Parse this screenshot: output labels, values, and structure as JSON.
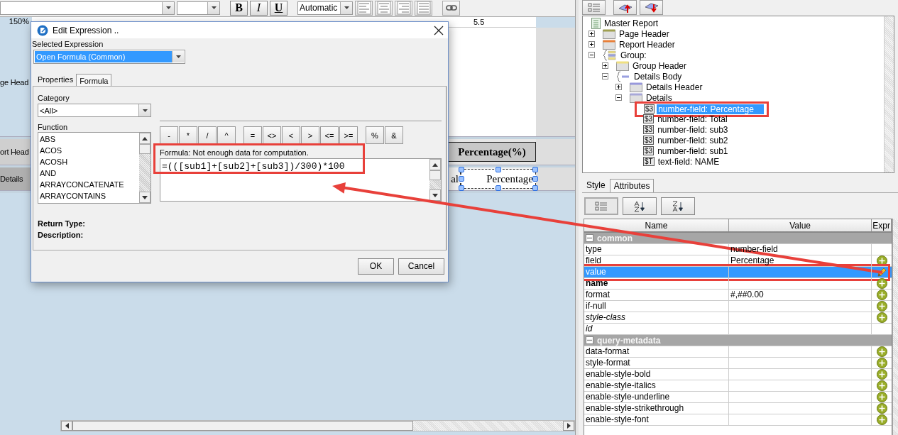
{
  "toolbar": {
    "format_buttons": [
      {
        "label": "B",
        "kind": "bold"
      },
      {
        "label": "I",
        "kind": "italic"
      },
      {
        "label": "U",
        "kind": "underline"
      }
    ],
    "color_select": "Automatic"
  },
  "canvas": {
    "zoom": "150%",
    "ruler_label": "5.5",
    "bands": [
      {
        "kind": "page-header",
        "label": "ge Head"
      },
      {
        "kind": "report-header",
        "label": "ort Head",
        "cells": [
          {
            "text": "Percentage(%)",
            "selected": false
          }
        ]
      },
      {
        "kind": "details",
        "label": "Details",
        "cells": [
          {
            "text": "al",
            "selected": false
          },
          {
            "text": "Percentage",
            "selected": true
          }
        ]
      }
    ]
  },
  "dialog": {
    "title": "Edit Expression ..",
    "selected_expression_label": "Selected Expression",
    "selected_expression": "Open Formula (Common)",
    "tabs": [
      {
        "label": "Properties",
        "selected": false
      },
      {
        "label": "Formula",
        "selected": true
      }
    ],
    "category_label": "Category",
    "category": "<All>",
    "function_label": "Function",
    "functions": [
      "ABS",
      "ACOS",
      "ACOSH",
      "AND",
      "ARRAYCONCATENATE",
      "ARRAYCONTAINS"
    ],
    "operators": [
      [
        "-",
        "*",
        "/",
        "^"
      ],
      [
        "=",
        "<>",
        "<",
        ">",
        "<=",
        ">="
      ],
      [
        "%",
        "&"
      ]
    ],
    "formula_label": "Formula: Not enough data for computation.",
    "formula": "=(([sub1]+[sub2]+[sub3])/300)*100",
    "formula_highlighted": true,
    "return_type_label": "Return Type:",
    "description_label": "Description:",
    "buttons": [
      "OK",
      "Cancel"
    ]
  },
  "outline": {
    "tree": [
      {
        "kind": "report",
        "label": "Master Report",
        "selected": false,
        "children": [
          {
            "kind": "band",
            "label": "Page Header",
            "color": "#a0a050",
            "expanded": false,
            "selected": false
          },
          {
            "kind": "band",
            "label": "Report Header",
            "color": "#e8803a",
            "expanded": false,
            "selected": false
          },
          {
            "kind": "group",
            "label": "Group:",
            "expanded": true,
            "selected": false,
            "children": [
              {
                "kind": "band",
                "label": "Group Header",
                "color": "#f0e080",
                "expanded": false,
                "selected": false
              },
              {
                "kind": "body",
                "label": "Details Body",
                "expanded": true,
                "selected": false,
                "children": [
                  {
                    "kind": "band",
                    "label": "Details Header",
                    "color": "#9898dc",
                    "expanded": false,
                    "selected": false
                  },
                  {
                    "kind": "band",
                    "label": "Details",
                    "color": "#a8a8d8",
                    "expanded": true,
                    "selected": false,
                    "children": [
                      {
                        "kind": "field",
                        "badge": "$3",
                        "label": "number-field: Percentage",
                        "selected": true,
                        "highlighted": true
                      },
                      {
                        "kind": "field",
                        "badge": "$3",
                        "label": "number-field: Total",
                        "selected": false,
                        "highlighted": false
                      },
                      {
                        "kind": "field",
                        "badge": "$3",
                        "label": "number-field: sub3",
                        "selected": false,
                        "highlighted": false
                      },
                      {
                        "kind": "field",
                        "badge": "$3",
                        "label": "number-field: sub2",
                        "selected": false,
                        "highlighted": false
                      },
                      {
                        "kind": "field",
                        "badge": "$3",
                        "label": "number-field: sub1",
                        "selected": false,
                        "highlighted": false
                      },
                      {
                        "kind": "field",
                        "badge": "$T",
                        "label": "text-field: NAME",
                        "selected": false,
                        "highlighted": false
                      }
                    ]
                  }
                ]
              }
            ]
          }
        ]
      }
    ]
  },
  "properties": {
    "tabs": [
      {
        "label": "Style",
        "selected": false
      },
      {
        "label": "Attributes",
        "selected": true
      }
    ],
    "columns": [
      "Name",
      "Value",
      "Expr"
    ],
    "rows": [
      {
        "kind": "group",
        "name": "common",
        "expanded": true
      },
      {
        "kind": "attribute",
        "name": "type",
        "value": "number-field",
        "bold": false,
        "italic": false,
        "expression_button": false,
        "selected": false,
        "highlighted": false
      },
      {
        "kind": "attribute",
        "name": "field",
        "value": "Percentage",
        "bold": false,
        "italic": false,
        "expression_button": true,
        "selected": false,
        "highlighted": false
      },
      {
        "kind": "attribute",
        "name": "value",
        "bold": false,
        "italic": false,
        "expression_button": true,
        "selected": true,
        "highlighted": true
      },
      {
        "kind": "attribute",
        "name": "name",
        "bold": true,
        "italic": false,
        "expression_button": true,
        "selected": false,
        "highlighted": false
      },
      {
        "kind": "attribute",
        "name": "format",
        "value": "#,##0.00",
        "bold": false,
        "italic": false,
        "expression_button": true,
        "selected": false,
        "highlighted": false
      },
      {
        "kind": "attribute",
        "name": "if-null",
        "bold": false,
        "italic": false,
        "expression_button": true,
        "selected": false,
        "highlighted": false
      },
      {
        "kind": "attribute",
        "name": "style-class",
        "bold": false,
        "italic": true,
        "expression_button": true,
        "selected": false,
        "highlighted": false
      },
      {
        "kind": "attribute",
        "name": "id",
        "bold": false,
        "italic": true,
        "expression_button": false,
        "selected": false,
        "highlighted": false
      },
      {
        "kind": "group",
        "name": "query-metadata",
        "expanded": true
      },
      {
        "kind": "attribute",
        "name": "data-format",
        "bold": false,
        "italic": false,
        "expression_button": true,
        "selected": false,
        "highlighted": false
      },
      {
        "kind": "attribute",
        "name": "style-format",
        "bold": false,
        "italic": false,
        "expression_button": true,
        "selected": false,
        "highlighted": false
      },
      {
        "kind": "attribute",
        "name": "enable-style-bold",
        "bold": false,
        "italic": false,
        "expression_button": true,
        "selected": false,
        "highlighted": false
      },
      {
        "kind": "attribute",
        "name": "enable-style-italics",
        "bold": false,
        "italic": false,
        "expression_button": true,
        "selected": false,
        "highlighted": false
      },
      {
        "kind": "attribute",
        "name": "enable-style-underline",
        "bold": false,
        "italic": false,
        "expression_button": true,
        "selected": false,
        "highlighted": false
      },
      {
        "kind": "attribute",
        "name": "enable-style-strikethrough",
        "bold": false,
        "italic": false,
        "expression_button": true,
        "selected": false,
        "highlighted": false
      },
      {
        "kind": "attribute",
        "name": "enable-style-font",
        "bold": false,
        "italic": false,
        "expression_button": true,
        "selected": false,
        "highlighted": false
      }
    ]
  },
  "callout_arrow": true
}
